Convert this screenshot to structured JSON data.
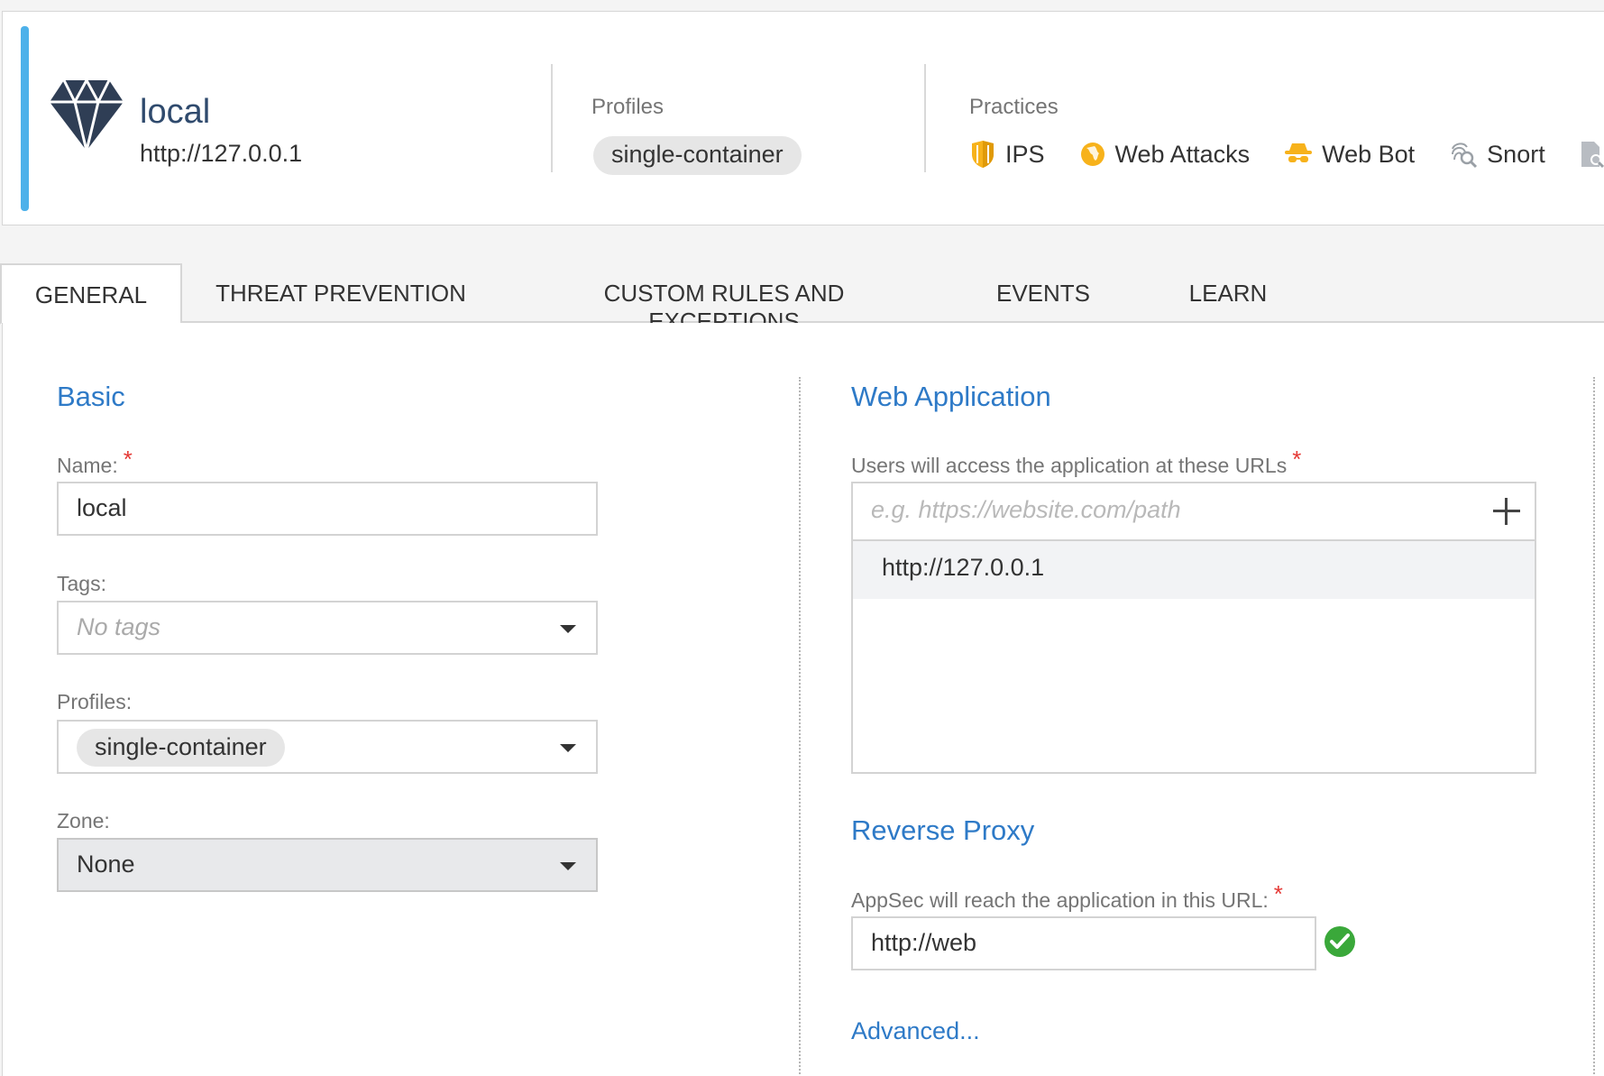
{
  "asset": {
    "name": "local",
    "url": "http://127.0.0.1"
  },
  "header": {
    "profiles_label": "Profiles",
    "profile_chip": "single-container",
    "practices_label": "Practices",
    "practices": [
      {
        "icon": "shield-icon",
        "label": "IPS"
      },
      {
        "icon": "globe-icon",
        "label": "Web Attacks"
      },
      {
        "icon": "spy-bot-icon",
        "label": "Web Bot"
      },
      {
        "icon": "fingerprint-search-icon",
        "label": "Snort"
      }
    ]
  },
  "tabs": [
    {
      "label": "GENERAL",
      "active": true
    },
    {
      "label": "THREAT PREVENTION"
    },
    {
      "label": "CUSTOM RULES AND EXCEPTIONS"
    },
    {
      "label": "EVENTS"
    },
    {
      "label": "LEARN"
    }
  ],
  "basic": {
    "title": "Basic",
    "name_label": "Name:",
    "name_value": "local",
    "tags_label": "Tags:",
    "tags_placeholder": "No tags",
    "profiles_label": "Profiles:",
    "profiles_value": "single-container",
    "zone_label": "Zone:",
    "zone_value": "None"
  },
  "web_application": {
    "title": "Web Application",
    "urls_label": "Users will access the application at these URLs",
    "url_placeholder": "e.g. https://website.com/path",
    "urls": [
      "http://127.0.0.1"
    ]
  },
  "reverse_proxy": {
    "title": "Reverse Proxy",
    "url_label": "AppSec will reach the application in this URL:",
    "url_value": "http://web",
    "advanced_link": "Advanced..."
  },
  "required_mark": "*",
  "colors": {
    "accent_bar": "#4db1ea",
    "section_title": "#2e7ac7",
    "required": "#e53935",
    "valid": "#3aa83a"
  }
}
